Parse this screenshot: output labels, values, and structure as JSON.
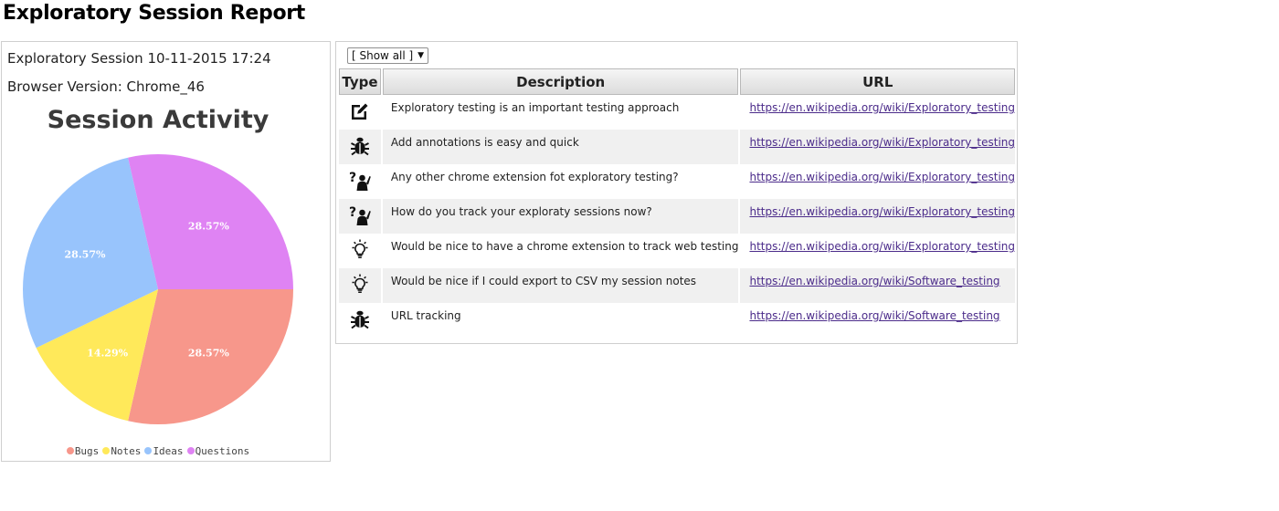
{
  "page": {
    "title": "Exploratory Session Report"
  },
  "session": {
    "name": "Exploratory Session 10-11-2015 17:24",
    "browser": "Browser Version: Chrome_46"
  },
  "filter": {
    "selected": "[ Show all ]"
  },
  "table": {
    "headers": {
      "type": "Type",
      "description": "Description",
      "url": "URL"
    },
    "rows": [
      {
        "type_icon": "note-icon",
        "description": "Exploratory testing is an important testing approach",
        "url": "https://en.wikipedia.org/wiki/Exploratory_testing"
      },
      {
        "type_icon": "bug-icon",
        "description": "Add annotations is easy and quick",
        "url": "https://en.wikipedia.org/wiki/Exploratory_testing"
      },
      {
        "type_icon": "question-icon",
        "description": "Any other chrome extension fot exploratory testing?",
        "url": "https://en.wikipedia.org/wiki/Exploratory_testing"
      },
      {
        "type_icon": "question-icon",
        "description": "How do you track your exploraty sessions now?",
        "url": "https://en.wikipedia.org/wiki/Exploratory_testing"
      },
      {
        "type_icon": "idea-icon",
        "description": "Would be nice to have a chrome extension to track web testing",
        "url": "https://en.wikipedia.org/wiki/Exploratory_testing"
      },
      {
        "type_icon": "idea-icon",
        "description": "Would be nice if I could export to CSV my session notes",
        "url": "https://en.wikipedia.org/wiki/Software_testing"
      },
      {
        "type_icon": "bug-icon",
        "description": "URL tracking",
        "url": "https://en.wikipedia.org/wiki/Software_testing"
      }
    ]
  },
  "chart_data": {
    "type": "pie",
    "title": "Session Activity",
    "categories": [
      "Bugs",
      "Notes",
      "Ideas",
      "Questions"
    ],
    "values": [
      28.57,
      14.29,
      28.57,
      28.57
    ],
    "labels": [
      "28.57%",
      "14.29%",
      "28.57%",
      "28.57%"
    ],
    "colors": [
      "#f7978b",
      "#ffe95a",
      "#98c4fc",
      "#df83f3"
    ],
    "legend_position": "bottom",
    "start_angle_deg": 0,
    "direction": "clockwise"
  }
}
